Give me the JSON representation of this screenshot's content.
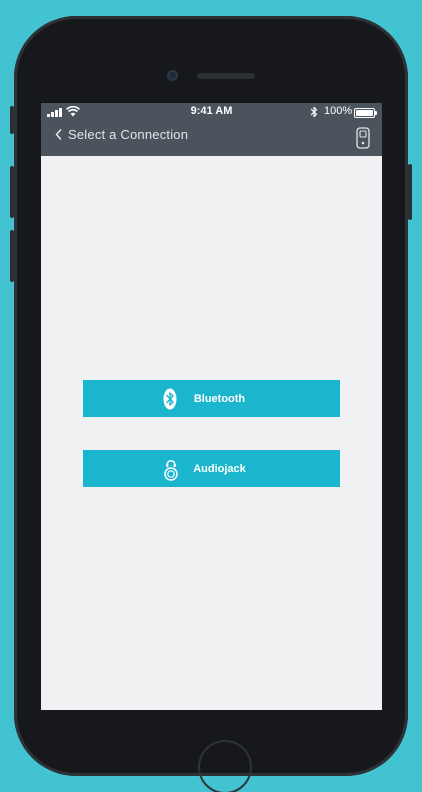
{
  "status_bar": {
    "time": "9:41 AM",
    "battery_percent": "100%",
    "battery_level": 1.0,
    "signal_bars": 4
  },
  "nav": {
    "title": "Select a Connection"
  },
  "connections": [
    {
      "label": "Bluetooth",
      "icon": "bluetooth-icon"
    },
    {
      "label": "Audiojack",
      "icon": "headphone-jack-icon"
    }
  ],
  "colors": {
    "background": "#43c3d1",
    "nav_bar": "#4b535d",
    "button": "#1bb6cd",
    "screen": "#f0f1f3"
  }
}
